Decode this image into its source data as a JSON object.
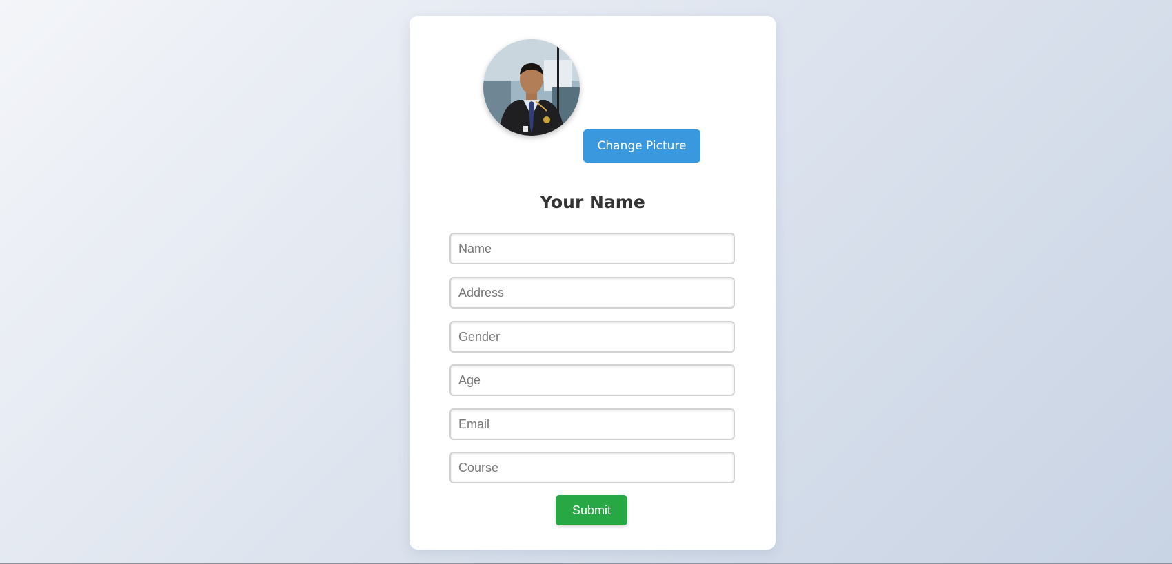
{
  "profile": {
    "change_picture_label": "Change Picture",
    "title": "Your Name"
  },
  "form": {
    "fields": [
      {
        "name": "name",
        "placeholder": "Name",
        "value": ""
      },
      {
        "name": "address",
        "placeholder": "Address",
        "value": ""
      },
      {
        "name": "gender",
        "placeholder": "Gender",
        "value": ""
      },
      {
        "name": "age",
        "placeholder": "Age",
        "value": ""
      },
      {
        "name": "email",
        "placeholder": "Email",
        "value": ""
      },
      {
        "name": "course",
        "placeholder": "Course",
        "value": ""
      }
    ],
    "submit_label": "Submit"
  },
  "colors": {
    "change_button": "#3a98de",
    "submit_button": "#28a745",
    "title_text": "#333333"
  }
}
